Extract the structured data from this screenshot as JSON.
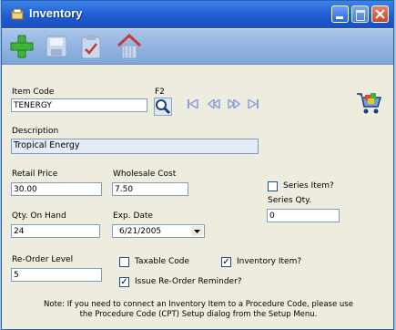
{
  "window": {
    "title": "Inventory"
  },
  "fields": {
    "item_code": {
      "label": "Item Code",
      "value": "TENERGY"
    },
    "f2": "F2",
    "description": {
      "label": "Description",
      "value": "Tropical Energy"
    },
    "retail_price": {
      "label": "Retail Price",
      "value": "30.00"
    },
    "wholesale_cost": {
      "label": "Wholesale Cost",
      "value": "7.50"
    },
    "series_item": {
      "label": "Series Item?",
      "checked": false
    },
    "series_qty": {
      "label": "Series Qty.",
      "value": "0"
    },
    "qty_on_hand": {
      "label": "Qty. On Hand",
      "value": "24"
    },
    "exp_date": {
      "label": "Exp. Date",
      "value": "6/21/2005"
    },
    "reorder_level": {
      "label": "Re-Order Level",
      "value": "5"
    },
    "taxable_code": {
      "label": "Taxable Code",
      "checked": false
    },
    "inventory_item": {
      "label": "Inventory Item?",
      "checked": true
    },
    "issue_reorder": {
      "label": "Issue Re-Order Reminder?",
      "checked": true
    }
  },
  "note": {
    "line1": "Note: If you need to connect an Inventory Item to a Procedure Code, please use",
    "line2": "the Procedure Code (CPT) Setup dialog from the Setup Menu."
  },
  "colors": {
    "titlebar": "#2a67d8",
    "toolbar": "#94b6e2",
    "window_bg": "#eeecdf",
    "outer_bg": "#9fc6d6"
  },
  "icons": [
    "add-icon",
    "save-icon",
    "clipboard-icon",
    "home-icon",
    "search-icon",
    "first-record-icon",
    "previous-record-icon",
    "next-record-icon",
    "last-record-icon",
    "cart-icon"
  ]
}
